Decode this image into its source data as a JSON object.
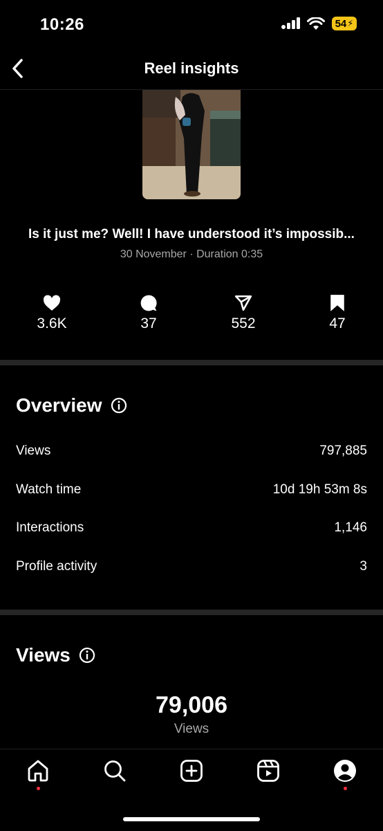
{
  "status_bar": {
    "time": "10:26",
    "battery": "54"
  },
  "header": {
    "title": "Reel insights"
  },
  "reel": {
    "title": "Is it just me? Well! I have understood it’s impossib...",
    "meta": "30 November · Duration 0:35"
  },
  "stats": {
    "likes": "3.6K",
    "comments": "37",
    "shares": "552",
    "saves": "47"
  },
  "overview": {
    "title": "Overview",
    "rows": [
      {
        "label": "Views",
        "value": "797,885"
      },
      {
        "label": "Watch time",
        "value": "10d 19h 53m 8s"
      },
      {
        "label": "Interactions",
        "value": "1,146"
      },
      {
        "label": "Profile activity",
        "value": "3"
      }
    ]
  },
  "views_section": {
    "title": "Views",
    "count": "79,006",
    "sub": "Views"
  },
  "colors": {
    "background": "#000000",
    "separator": "#262626",
    "notification_dot": "#ff3040",
    "battery": "#f5c518"
  },
  "icons": [
    "back-chevron-icon",
    "heart-icon",
    "comment-icon",
    "share-icon",
    "bookmark-icon",
    "info-icon",
    "home-icon",
    "search-icon",
    "create-icon",
    "reels-icon",
    "profile-icon"
  ]
}
